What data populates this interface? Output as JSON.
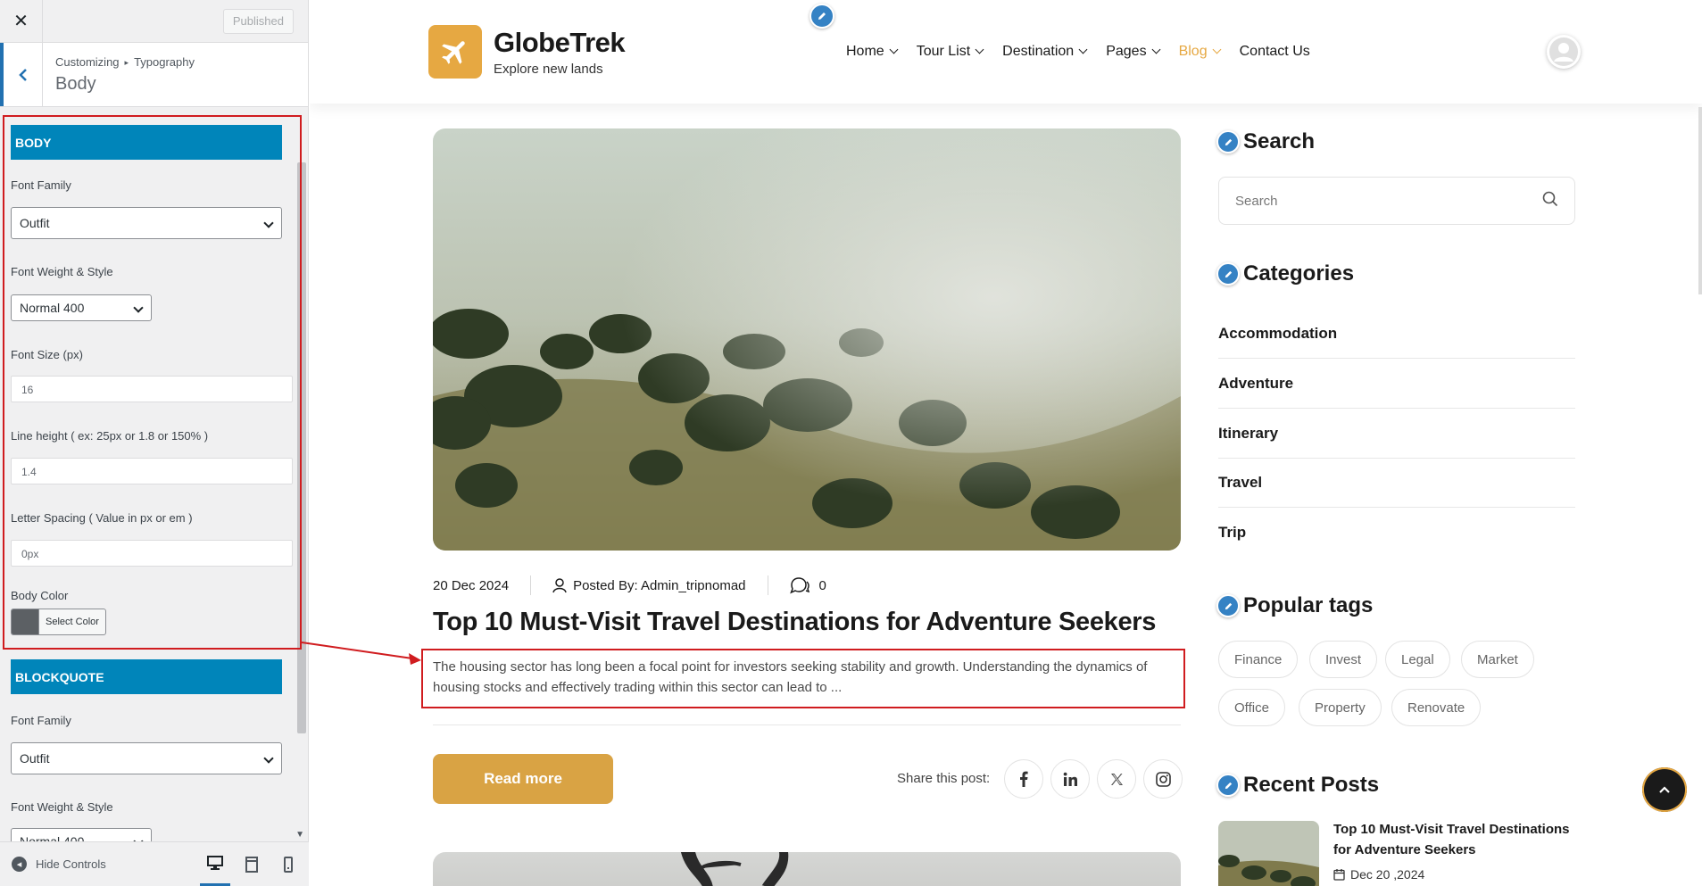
{
  "customizer": {
    "published_label": "Published",
    "breadcrumb": [
      "Customizing",
      "Typography"
    ],
    "section_title": "Body",
    "body_group": {
      "heading": "BODY",
      "font_family_label": "Font Family",
      "font_family_value": "Outfit",
      "font_weight_label": "Font Weight & Style",
      "font_weight_value": "Normal 400",
      "font_size_label": "Font Size (px)",
      "font_size_value": "16",
      "line_height_label": "Line height ( ex: 25px or 1.8 or 150% )",
      "line_height_value": "1.4",
      "letter_spacing_label": "Letter Spacing ( Value in px or em )",
      "letter_spacing_value": "0px",
      "body_color_label": "Body Color",
      "body_color_button": "Select Color",
      "body_color_value": "#5c6064"
    },
    "blockquote_group": {
      "heading": "BLOCKQUOTE",
      "font_family_label": "Font Family",
      "font_family_value": "Outfit",
      "font_weight_label": "Font Weight & Style",
      "font_weight_value": "Normal 400"
    },
    "hide_controls_label": "Hide Controls"
  },
  "site": {
    "name": "GlobeTrek",
    "tagline": "Explore new lands",
    "nav": [
      {
        "label": "Home",
        "dropdown": true
      },
      {
        "label": "Tour List",
        "dropdown": true
      },
      {
        "label": "Destination",
        "dropdown": true
      },
      {
        "label": "Pages",
        "dropdown": true
      },
      {
        "label": "Blog",
        "dropdown": true,
        "active": true
      },
      {
        "label": "Contact Us",
        "dropdown": false
      }
    ],
    "accent_color": "#e6a842"
  },
  "post": {
    "date": "20 Dec 2024",
    "author": "Posted By: Admin_tripnomad",
    "comments": "0",
    "title": "Top 10 Must-Visit Travel Destinations for Adventure Seekers",
    "excerpt": "The housing sector has long been a focal point for investors seeking stability and growth. Understanding the dynamics of housing stocks and effectively trading within this sector can lead to ...",
    "read_more": "Read more",
    "share_label": "Share this post:",
    "share_icons": [
      "facebook-icon",
      "linkedin-icon",
      "x-icon",
      "instagram-icon"
    ]
  },
  "widgets": {
    "search_title": "Search",
    "search_placeholder": "Search",
    "categories_title": "Categories",
    "categories": [
      "Accommodation",
      "Adventure",
      "Itinerary",
      "Travel",
      "Trip"
    ],
    "tags_title": "Popular tags",
    "tags": [
      "Finance",
      "Invest",
      "Legal",
      "Market",
      "Office",
      "Property",
      "Renovate"
    ],
    "recent_title": "Recent Posts",
    "recent_post_title": "Top 10 Must-Visit Travel Destinations for Adventure Seekers",
    "recent_post_date": "Dec 20 ,2024"
  }
}
